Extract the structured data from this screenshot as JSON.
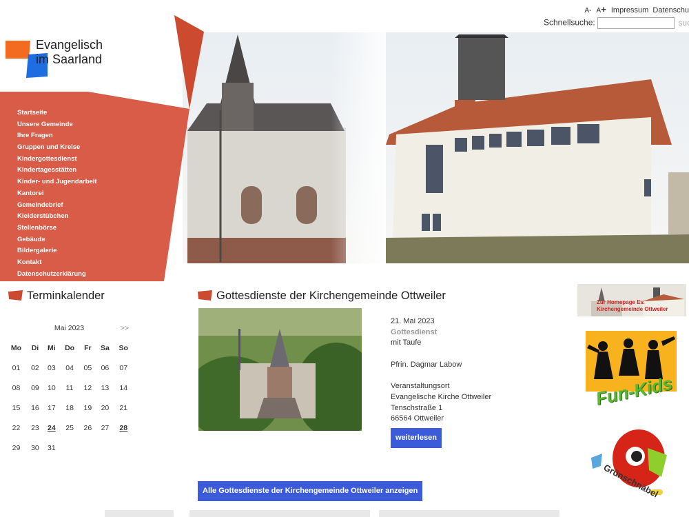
{
  "colors": {
    "accent": "#cc4a30",
    "nav_bg": "#d85c48",
    "button": "#3b5bdb",
    "logo_orange": "#f26b20",
    "logo_blue": "#1f6de0"
  },
  "top": {
    "font_decrease": "A-",
    "font_increase": "A+",
    "impressum": "Impressum",
    "datenschutz": "Datenschu"
  },
  "search": {
    "label": "Schnellsuche:",
    "value": "",
    "button": "suche"
  },
  "logo": {
    "line1": "Evangelisch",
    "line2": "im Saarland"
  },
  "nav": [
    "Startseite",
    "Unsere Gemeinde",
    "Ihre Fragen",
    "Gruppen und Kreise",
    "Kindergottesdienst",
    "Kindertagesstätten",
    "Kinder- und Jugendarbeit",
    "Kantorei",
    "Gemeindebrief",
    "Kleiderstübchen",
    "Stellenbörse",
    "Gebäude",
    "Bildergalerie",
    "Kontakt",
    "Datenschutzerklärung"
  ],
  "calendar": {
    "title": "Terminkalender",
    "month": "Mai 2023",
    "next": ">>",
    "weekdays": [
      "Mo",
      "Di",
      "Mi",
      "Do",
      "Fr",
      "Sa",
      "So"
    ],
    "weeks": [
      [
        "01",
        "02",
        "03",
        "04",
        "05",
        "06",
        "07"
      ],
      [
        "08",
        "09",
        "10",
        "11",
        "12",
        "13",
        "14"
      ],
      [
        "15",
        "16",
        "17",
        "18",
        "19",
        "20",
        "21"
      ],
      [
        "22",
        "23",
        "24",
        "25",
        "26",
        "27",
        "28"
      ],
      [
        "29",
        "30",
        "31",
        "",
        "",
        "",
        ""
      ]
    ],
    "event_days": [
      "24",
      "28"
    ]
  },
  "services": {
    "title": "Gottesdienste der Kirchengemeinde Ottweiler",
    "date": "21. Mai 2023",
    "type": "Gottesdienst",
    "note": "mit Taufe",
    "pastor": "Pfrin. Dagmar Labow",
    "venue_label": "Veranstaltungsort",
    "venue": "Evangelische Kirche Ottweiler",
    "street": "Tenschstraße 1",
    "city": "66564 Ottweiler",
    "read_more": "weiterlesen",
    "all_button": "Alle Gottesdienste der Kirchengemeinde Ottweiler anzeigen"
  },
  "sidebar": {
    "banner_line1": "Zur Homepage Ev.",
    "banner_line2": "Kirchengemeinde Ottweiler",
    "funkids": "Fun-Kids",
    "gruenschnaebel": "Grünschnäbel"
  }
}
